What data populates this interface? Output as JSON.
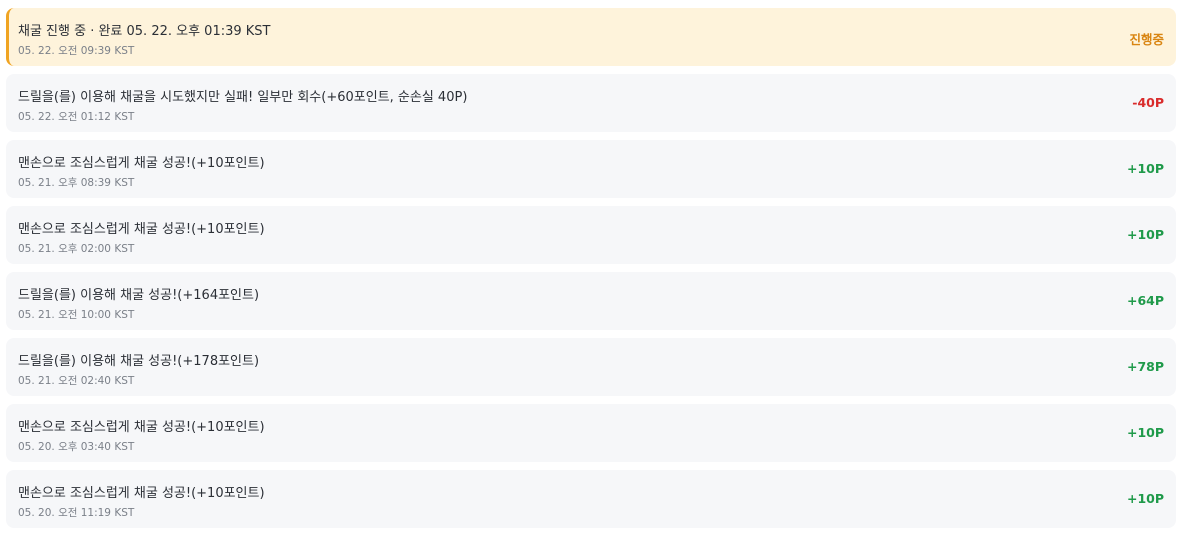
{
  "colors": {
    "gain": "#1f9a4a",
    "loss": "#d92b2b",
    "pending": "#d98512",
    "active_bg": "#fef3db",
    "active_border": "#f0a422",
    "row_bg": "#f6f7f9"
  },
  "rows": [
    {
      "title": "채굴 진행 중 · 완료 05. 22. 오후 01:39 KST",
      "time": "05. 22. 오전 09:39 KST",
      "amount": "진행중",
      "status": "pending"
    },
    {
      "title": "드릴을(를) 이용해 채굴을 시도했지만 실패! 일부만 회수(+60포인트, 순손실 40P)",
      "time": "05. 22. 오전 01:12 KST",
      "amount": "-40P",
      "status": "loss"
    },
    {
      "title": "맨손으로 조심스럽게 채굴 성공!(+10포인트)",
      "time": "05. 21. 오후 08:39 KST",
      "amount": "+10P",
      "status": "gain"
    },
    {
      "title": "맨손으로 조심스럽게 채굴 성공!(+10포인트)",
      "time": "05. 21. 오후 02:00 KST",
      "amount": "+10P",
      "status": "gain"
    },
    {
      "title": "드릴을(를) 이용해 채굴 성공!(+164포인트)",
      "time": "05. 21. 오전 10:00 KST",
      "amount": "+64P",
      "status": "gain"
    },
    {
      "title": "드릴을(를) 이용해 채굴 성공!(+178포인트)",
      "time": "05. 21. 오전 02:40 KST",
      "amount": "+78P",
      "status": "gain"
    },
    {
      "title": "맨손으로 조심스럽게 채굴 성공!(+10포인트)",
      "time": "05. 20. 오후 03:40 KST",
      "amount": "+10P",
      "status": "gain"
    },
    {
      "title": "맨손으로 조심스럽게 채굴 성공!(+10포인트)",
      "time": "05. 20. 오전 11:19 KST",
      "amount": "+10P",
      "status": "gain"
    }
  ]
}
